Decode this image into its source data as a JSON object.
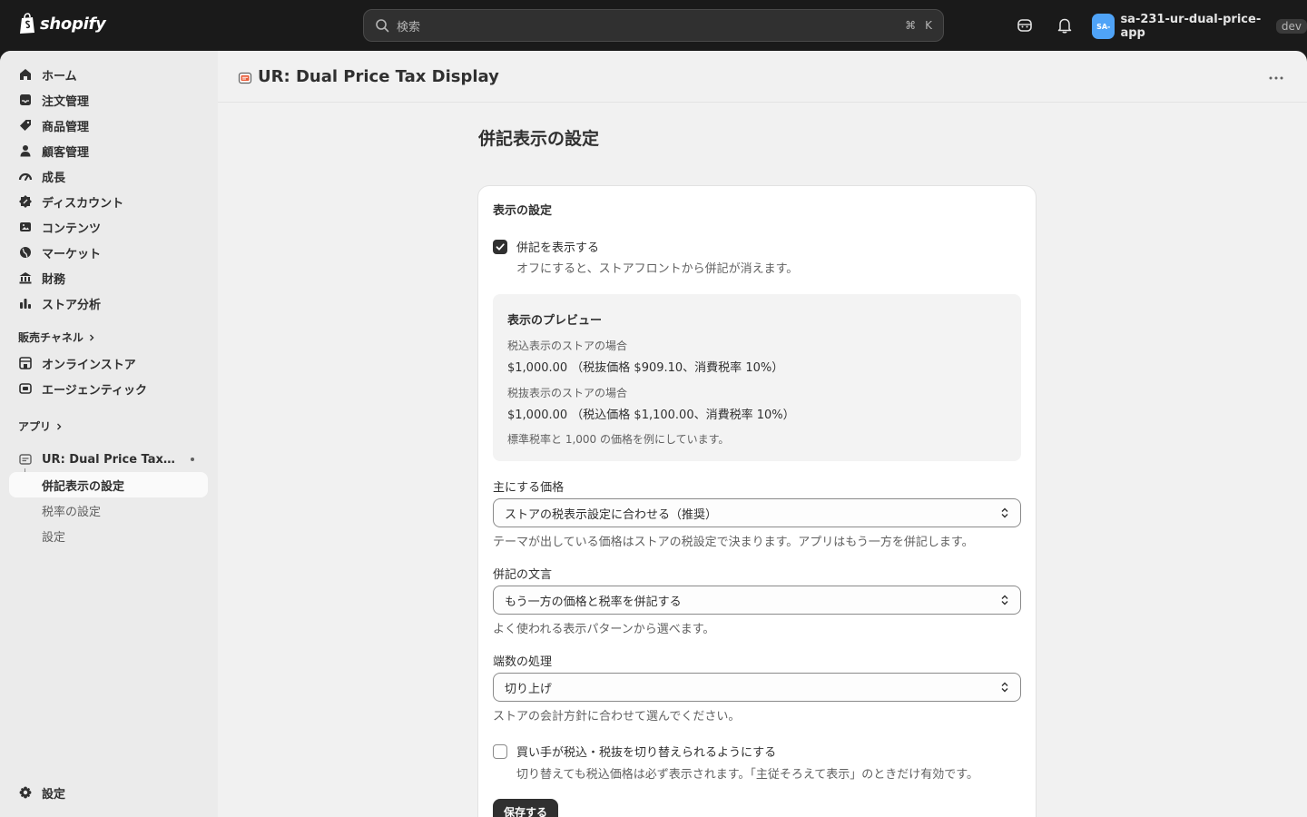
{
  "topbar": {
    "logo_text": "shopify",
    "search_placeholder": "検索",
    "shortcut_cmd": "⌘",
    "shortcut_key": "K",
    "account_initials": "SA-",
    "store_name": "sa-231-ur-dual-price-app",
    "env_badge": "dev"
  },
  "sidebar": {
    "items": [
      {
        "label": "ホーム",
        "icon": "home-icon"
      },
      {
        "label": "注文管理",
        "icon": "inbox-icon"
      },
      {
        "label": "商品管理",
        "icon": "tag-icon"
      },
      {
        "label": "顧客管理",
        "icon": "person-icon"
      },
      {
        "label": "成長",
        "icon": "gauge-icon"
      },
      {
        "label": "ディスカウント",
        "icon": "discount-icon"
      },
      {
        "label": "コンテンツ",
        "icon": "image-icon"
      },
      {
        "label": "マーケット",
        "icon": "globe-icon"
      },
      {
        "label": "財務",
        "icon": "bank-icon"
      },
      {
        "label": "ストア分析",
        "icon": "chart-icon"
      }
    ],
    "sales_channels_heading": "販売チャネル",
    "channels": [
      {
        "label": "オンラインストア",
        "icon": "store-icon"
      },
      {
        "label": "エージェンティック",
        "icon": "robot-icon"
      }
    ],
    "apps_heading": "アプリ",
    "app_name": "UR: Dual Price Tax Dis...",
    "app_subitems": [
      "併記表示の設定",
      "税率の設定",
      "設定"
    ],
    "settings_label": "設定"
  },
  "app_header": {
    "title": "UR: Dual Price Tax Display"
  },
  "page": {
    "title": "併記表示の設定",
    "card_title": "表示の設定",
    "show_dual": {
      "label": "併記を表示する",
      "checked": true,
      "help": "オフにすると、ストアフロントから併記が消えます。"
    },
    "preview": {
      "title": "表示のプレビュー",
      "incl_caption": "税込表示のストアの場合",
      "incl_value": "$1,000.00 （税抜価格 $909.10、消費税率 10%）",
      "excl_caption": "税抜表示のストアの場合",
      "excl_value": "$1,000.00 （税込価格 $1,100.00、消費税率 10%）",
      "note": "標準税率と 1,000 の価格を例にしています。"
    },
    "primary_price": {
      "label": "主にする価格",
      "value": "ストアの税表示設定に合わせる（推奨）",
      "help": "テーマが出している価格はストアの税設定で決まります。アプリはもう一方を併記します。"
    },
    "wording": {
      "label": "併記の文言",
      "value": "もう一方の価格と税率を併記する",
      "help": "よく使われる表示パターンから選べます。"
    },
    "rounding": {
      "label": "端数の処理",
      "value": "切り上げ",
      "help": "ストアの会計方針に合わせて選んでください。"
    },
    "toggle_buyer": {
      "label": "買い手が税込・税抜を切り替えられるようにする",
      "checked": false,
      "help": "切り替えても税込価格は必ず表示されます。「主従そろえて表示」のときだけ有効です。"
    },
    "save_label": "保存する"
  }
}
